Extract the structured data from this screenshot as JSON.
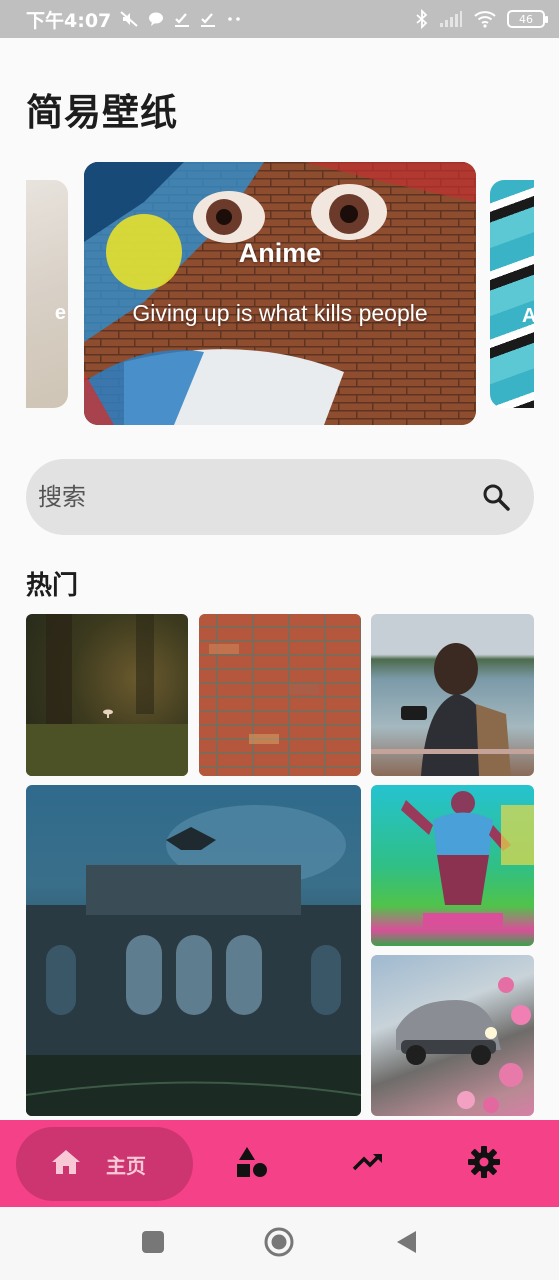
{
  "status_bar": {
    "time": "下午4:07",
    "battery": "46"
  },
  "app": {
    "title": "简易壁纸"
  },
  "carousel": {
    "prev_edge_text": "e",
    "main": {
      "title": "Anime",
      "subtitle": "Giving up is what kills people"
    },
    "next_edge_text": "A"
  },
  "search": {
    "placeholder": "搜索"
  },
  "section": {
    "title": "热门"
  },
  "bottom_nav": {
    "home_label": "主页"
  },
  "colors": {
    "accent": "#f54187",
    "accent_dark": "#cc3570"
  }
}
